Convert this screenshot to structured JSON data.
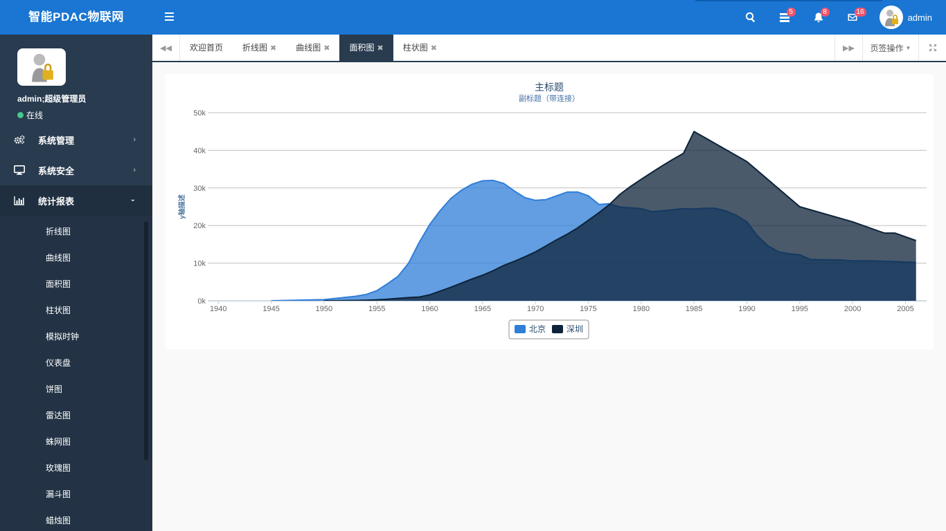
{
  "header": {
    "brand": "智能PDAC物联网",
    "badges": {
      "list": "5",
      "bell": "8",
      "mail": "16"
    },
    "username": "admin",
    "icons": [
      "menu-icon",
      "search-icon",
      "list-icon",
      "bell-icon",
      "mail-icon",
      "avatar"
    ]
  },
  "sidebar": {
    "profile_name": "admin;超级管理员",
    "status": "在线",
    "nav": [
      {
        "label": "系统管理",
        "icon": "gears-icon"
      },
      {
        "label": "系统安全",
        "icon": "monitor-icon"
      },
      {
        "label": "统计报表",
        "icon": "bar-chart-icon"
      }
    ],
    "sub": [
      "折线图",
      "曲线图",
      "面积图",
      "柱状图",
      "模拟时钟",
      "仪表盘",
      "饼图",
      "雷达图",
      "蛛网图",
      "玫瑰图",
      "漏斗图",
      "蜡烛图"
    ]
  },
  "tabs": {
    "items": [
      "欢迎首页",
      "折线图",
      "曲线图",
      "面积图",
      "柱状图"
    ],
    "active": 3,
    "ops_label": "页签操作"
  },
  "colors": {
    "header": "#1a76d2",
    "sidebar": "#283b4f",
    "series1": "#2f7ed8",
    "series2": "#0d233a"
  },
  "chart_data": {
    "type": "area",
    "title": "主标题",
    "subtitle": "副标题（带连接）",
    "ylabel": "y轴描述",
    "xlabel": "",
    "xlim": [
      1939,
      2007
    ],
    "ylim": [
      0,
      50000
    ],
    "x_ticks": [
      1940,
      1945,
      1950,
      1955,
      1960,
      1965,
      1970,
      1975,
      1980,
      1985,
      1990,
      1995,
      2000,
      2005
    ],
    "y_ticks": [
      0,
      10000,
      20000,
      30000,
      40000,
      50000
    ],
    "y_tick_labels": [
      "0k",
      "10k",
      "20k",
      "30k",
      "40k",
      "50k"
    ],
    "legend_position": "bottom-center",
    "series": [
      {
        "name": "北京",
        "color": "#2f7ed8",
        "points": [
          [
            1945,
            0
          ],
          [
            1950,
            300
          ],
          [
            1951,
            600
          ],
          [
            1952,
            900
          ],
          [
            1953,
            1200
          ],
          [
            1954,
            1700
          ],
          [
            1955,
            2700
          ],
          [
            1956,
            4500
          ],
          [
            1957,
            6500
          ],
          [
            1958,
            10000
          ],
          [
            1959,
            15500
          ],
          [
            1960,
            20300
          ],
          [
            1961,
            24000
          ],
          [
            1962,
            27200
          ],
          [
            1963,
            29400
          ],
          [
            1964,
            31000
          ],
          [
            1965,
            31900
          ],
          [
            1966,
            32000
          ],
          [
            1967,
            31200
          ],
          [
            1968,
            29200
          ],
          [
            1969,
            27400
          ],
          [
            1970,
            26700
          ],
          [
            1971,
            26900
          ],
          [
            1972,
            27900
          ],
          [
            1973,
            28900
          ],
          [
            1974,
            28900
          ],
          [
            1975,
            27900
          ],
          [
            1976,
            25600
          ],
          [
            1977,
            25800
          ],
          [
            1978,
            24900
          ],
          [
            1979,
            24700
          ],
          [
            1980,
            24500
          ],
          [
            1981,
            23700
          ],
          [
            1982,
            23900
          ],
          [
            1983,
            24200
          ],
          [
            1984,
            24500
          ],
          [
            1985,
            24400
          ],
          [
            1986,
            24600
          ],
          [
            1987,
            24600
          ],
          [
            1988,
            23900
          ],
          [
            1989,
            22700
          ],
          [
            1990,
            21000
          ],
          [
            1991,
            17200
          ],
          [
            1992,
            14600
          ],
          [
            1993,
            13000
          ],
          [
            1994,
            12500
          ],
          [
            1995,
            12200
          ],
          [
            1996,
            11000
          ],
          [
            1997,
            10900
          ],
          [
            1998,
            10900
          ],
          [
            1999,
            10800
          ],
          [
            2000,
            10600
          ],
          [
            2001,
            10600
          ],
          [
            2002,
            10600
          ],
          [
            2003,
            10500
          ],
          [
            2004,
            10400
          ],
          [
            2005,
            10300
          ],
          [
            2006,
            10200
          ]
        ]
      },
      {
        "name": "深圳",
        "color": "#0d233a",
        "points": [
          [
            1950,
            0
          ],
          [
            1951,
            10
          ],
          [
            1952,
            50
          ],
          [
            1953,
            100
          ],
          [
            1954,
            150
          ],
          [
            1955,
            250
          ],
          [
            1956,
            400
          ],
          [
            1957,
            650
          ],
          [
            1958,
            850
          ],
          [
            1959,
            1000
          ],
          [
            1960,
            1600
          ],
          [
            1961,
            2600
          ],
          [
            1962,
            3600
          ],
          [
            1963,
            4700
          ],
          [
            1964,
            5800
          ],
          [
            1965,
            6800
          ],
          [
            1966,
            8000
          ],
          [
            1967,
            9400
          ],
          [
            1968,
            10500
          ],
          [
            1969,
            11700
          ],
          [
            1970,
            13000
          ],
          [
            1971,
            14600
          ],
          [
            1972,
            16200
          ],
          [
            1973,
            17700
          ],
          [
            1974,
            19400
          ],
          [
            1975,
            21400
          ],
          [
            1976,
            23400
          ],
          [
            1977,
            25600
          ],
          [
            1978,
            28300
          ],
          [
            1979,
            30400
          ],
          [
            1980,
            32300
          ],
          [
            1981,
            34100
          ],
          [
            1982,
            35900
          ],
          [
            1983,
            37600
          ],
          [
            1984,
            39200
          ],
          [
            1985,
            45000
          ],
          [
            1990,
            37000
          ],
          [
            1995,
            25000
          ],
          [
            2000,
            21000
          ],
          [
            2003,
            18000
          ],
          [
            2004,
            18000
          ],
          [
            2006,
            16000
          ]
        ]
      }
    ]
  }
}
